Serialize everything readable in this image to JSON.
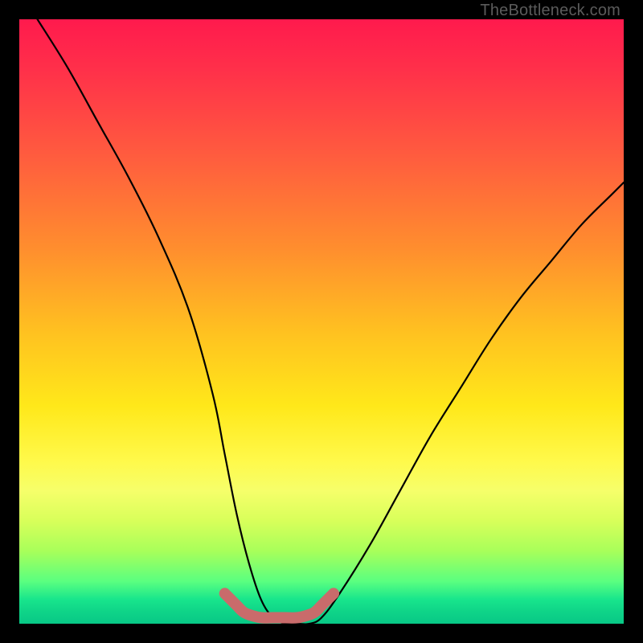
{
  "attribution": "TheBottleneck.com",
  "chart_data": {
    "type": "line",
    "title": "",
    "xlabel": "",
    "ylabel": "",
    "xlim": [
      0,
      100
    ],
    "ylim": [
      0,
      100
    ],
    "series": [
      {
        "name": "bottleneck-curve",
        "x": [
          3,
          8,
          13,
          18,
          23,
          28,
          32,
          34,
          36,
          38,
          40,
          42,
          44,
          46,
          48,
          50,
          53,
          58,
          63,
          68,
          73,
          78,
          83,
          88,
          93,
          98,
          100
        ],
        "y": [
          100,
          92,
          83,
          74,
          64,
          52,
          38,
          28,
          18,
          10,
          4,
          1,
          0,
          0,
          0,
          1,
          5,
          13,
          22,
          31,
          39,
          47,
          54,
          60,
          66,
          71,
          73
        ]
      },
      {
        "name": "optimal-band-marker",
        "x": [
          34,
          35,
          36,
          37,
          38,
          40,
          42,
          44,
          46,
          48,
          49,
          50,
          51,
          52
        ],
        "y": [
          5,
          4,
          3,
          2,
          1.5,
          1,
          1,
          1,
          1,
          1.5,
          2,
          3,
          4,
          5
        ]
      }
    ],
    "colors": {
      "curve": "#000000",
      "marker": "#c96b6b",
      "gradient_top": "#ff1a4d",
      "gradient_bottom": "#08c886"
    }
  }
}
